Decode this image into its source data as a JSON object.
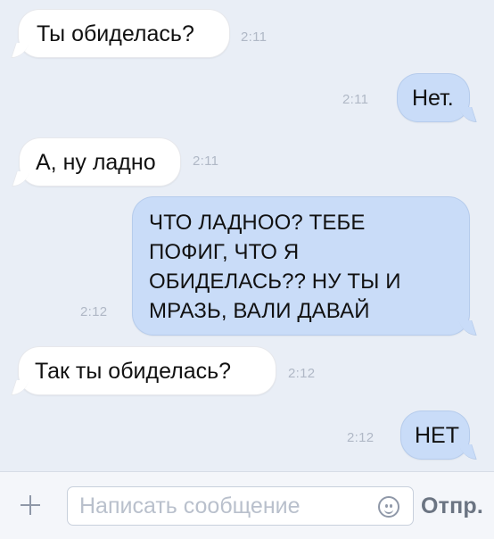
{
  "messages": [
    {
      "text": "Ты обиделась?",
      "time": "2:11"
    },
    {
      "text": "Нет.",
      "time": "2:11"
    },
    {
      "text": "А, ну ладно",
      "time": "2:11"
    },
    {
      "text": "ЧТО ЛАДНОО? ТЕБЕ\nПОФИГ, ЧТО Я\nОБИДЕЛАСЬ?? НУ ТЫ И\nМРАЗЬ, ВАЛИ ДАВАЙ",
      "time": "2:12"
    },
    {
      "text": "Так ты обиделась?",
      "time": "2:12"
    },
    {
      "text": "НЕТ",
      "time": "2:12"
    }
  ],
  "composer": {
    "placeholder": "Написать сообщение",
    "send_label": "Отпр.",
    "attach_icon": "plus-icon",
    "emoji_icon": "emoji-icon"
  },
  "colors": {
    "background": "#e9eef6",
    "incoming_bubble": "#ffffff",
    "outgoing_bubble": "#c9dcf8",
    "timestamp": "#b0b8c6"
  }
}
